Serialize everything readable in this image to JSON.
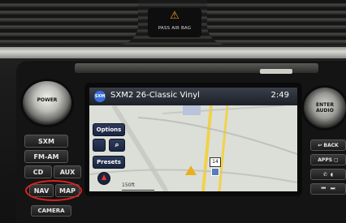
{
  "airbag": {
    "label": "PASS AIR BAG"
  },
  "knobs": {
    "power_label": "POWER",
    "enter_label": "ENTER\nAUDIO"
  },
  "left_buttons": {
    "sxm": "SXM",
    "fm_am": "FM-AM",
    "cd": "CD",
    "aux": "AUX",
    "nav": "NAV",
    "map": "MAP",
    "camera": "CAMERA"
  },
  "screen": {
    "logo": "SXM",
    "station": "SXM2 26-Classic Vinyl",
    "clock": "2:49",
    "options_label": "Options",
    "presets_label": "Presets",
    "zoom_icon": "magnifier-icon",
    "scale_label": "150ft",
    "route_marker": "14"
  },
  "right_buttons": {
    "back": "BACK",
    "apps": "APPS"
  },
  "colors": {
    "highlight_circle": "#e02020",
    "top_bar": "#1c2027",
    "screen_button": "#1a2540",
    "vehicle_arrow": "#e8b020"
  }
}
